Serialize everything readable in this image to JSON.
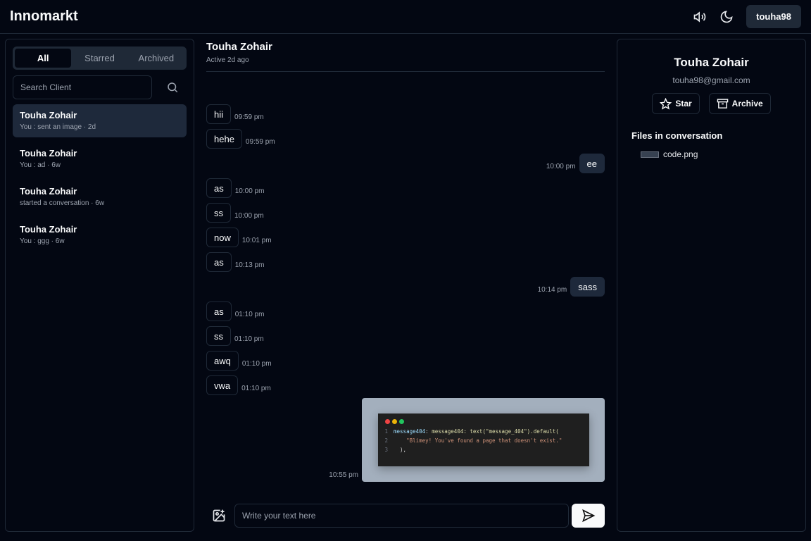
{
  "app": {
    "title": "Innomarkt",
    "user": "touha98",
    "icons": [
      "speaker-icon",
      "moon-icon"
    ]
  },
  "sidebar": {
    "tabs": [
      "All",
      "Starred",
      "Archived"
    ],
    "search_placeholder": "Search Client",
    "conversations": [
      {
        "name": "Touha Zohair",
        "preview": "You : sent an image · 2d",
        "active": true
      },
      {
        "name": "Touha Zohair",
        "preview": "You : ad · 6w"
      },
      {
        "name": "Touha Zohair",
        "preview": "started a conversation · 6w"
      },
      {
        "name": "Touha Zohair",
        "preview": "You : ggg · 6w"
      }
    ]
  },
  "chat": {
    "name": "Touha Zohair",
    "status": "Active 2d ago",
    "messages": [
      {
        "text": "hii",
        "time": "09:59 pm",
        "dir": "in"
      },
      {
        "text": "hehe",
        "time": "09:59 pm",
        "dir": "in"
      },
      {
        "text": "ee",
        "time": "10:00 pm",
        "dir": "out"
      },
      {
        "text": "as",
        "time": "10:00 pm",
        "dir": "in"
      },
      {
        "text": "ss",
        "time": "10:00 pm",
        "dir": "in"
      },
      {
        "text": "now",
        "time": "10:01 pm",
        "dir": "in"
      },
      {
        "text": "as",
        "time": "10:13 pm",
        "dir": "in"
      },
      {
        "text": "sass",
        "time": "10:14 pm",
        "dir": "out"
      },
      {
        "text": "as",
        "time": "01:10 pm",
        "dir": "in"
      },
      {
        "text": "ss",
        "time": "01:10 pm",
        "dir": "in"
      },
      {
        "text": "awq",
        "time": "01:10 pm",
        "dir": "in"
      },
      {
        "text": "vwa",
        "time": "01:10 pm",
        "dir": "in"
      }
    ],
    "image_message": {
      "time": "10:55 pm",
      "code_lines": [
        "message404: text(\"message_404\").default(",
        "    \"Blimey! You've found a page that doesn't exist.\"",
        "  ),"
      ]
    },
    "composer_placeholder": "Write your text here"
  },
  "details": {
    "name": "Touha Zohair",
    "email": "touha98@gmail.com",
    "star_label": "Star",
    "archive_label": "Archive",
    "files_heading": "Files in conversation",
    "files": [
      "code.png"
    ]
  }
}
